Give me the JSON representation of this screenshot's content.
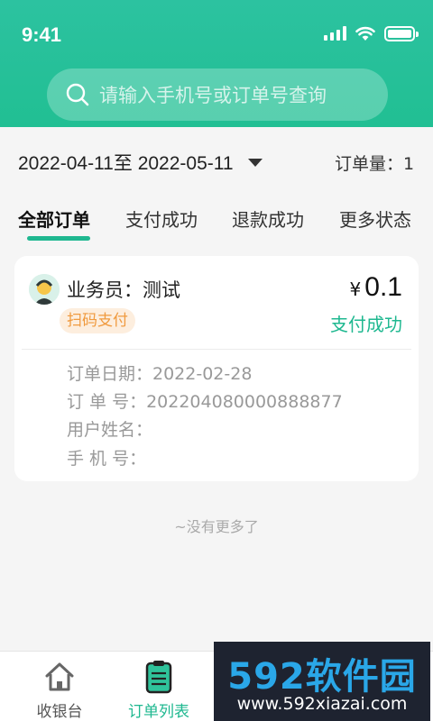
{
  "status_bar": {
    "time": "9:41"
  },
  "search": {
    "placeholder": "请输入手机号或订单号查询"
  },
  "filter": {
    "date_range": "2022-04-11至 2022-05-11",
    "order_count": "订单量：1"
  },
  "tabs": [
    {
      "label": "全部订单",
      "active": true
    },
    {
      "label": "支付成功",
      "active": false
    },
    {
      "label": "退款成功",
      "active": false
    },
    {
      "label": "更多状态",
      "active": false
    }
  ],
  "order": {
    "salesman": "业务员：测试",
    "pay_method": "扫码支付",
    "currency": "¥",
    "amount": "0.1",
    "status": "支付成功",
    "details": [
      {
        "text": "订单日期：2022-02-28"
      },
      {
        "text": "订  单  号：20220408000088887​7"
      },
      {
        "text": "用户姓名："
      },
      {
        "text": "手    机  号："
      }
    ]
  },
  "list_end": "~没有更多了",
  "tabbar": [
    {
      "label": "收银台",
      "icon": "home-icon",
      "active": false
    },
    {
      "label": "订单列表",
      "icon": "clipboard-icon",
      "active": true
    },
    {
      "label": "",
      "icon": "user-icon",
      "active": false
    },
    {
      "label": "",
      "icon": "more-icon",
      "active": false
    }
  ],
  "watermark": {
    "brand": "592软件园",
    "url": "www.592xiazai.com"
  },
  "colors": {
    "primary": "#1fb890",
    "badge_text": "#f09a3e",
    "badge_bg": "#fdeede"
  }
}
